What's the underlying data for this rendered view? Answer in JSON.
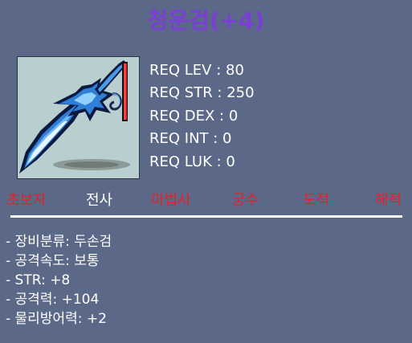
{
  "item": {
    "name": "청운검(+4)",
    "icon": "blue-two-handed-sword-icon"
  },
  "requirements": [
    "REQ LEV : 80",
    "REQ STR : 250",
    "REQ DEX : 0",
    "REQ INT : 0",
    "REQ LUK : 0"
  ],
  "classes": [
    {
      "label": "초보자",
      "eligible": false
    },
    {
      "label": "전사",
      "eligible": true
    },
    {
      "label": "마법사",
      "eligible": false
    },
    {
      "label": "궁수",
      "eligible": false
    },
    {
      "label": "도적",
      "eligible": false
    },
    {
      "label": "해적",
      "eligible": false
    }
  ],
  "stats": [
    "- 장비분류: 두손검",
    "- 공격속도: 보통",
    "- STR: +8",
    "- 공격력: +104",
    "- 물리방어력: +2"
  ],
  "colors": {
    "background": "#5b6887",
    "title": "#7b3fd6",
    "ineligible_class": "#e8202a",
    "eligible_class": "#ffffff"
  }
}
